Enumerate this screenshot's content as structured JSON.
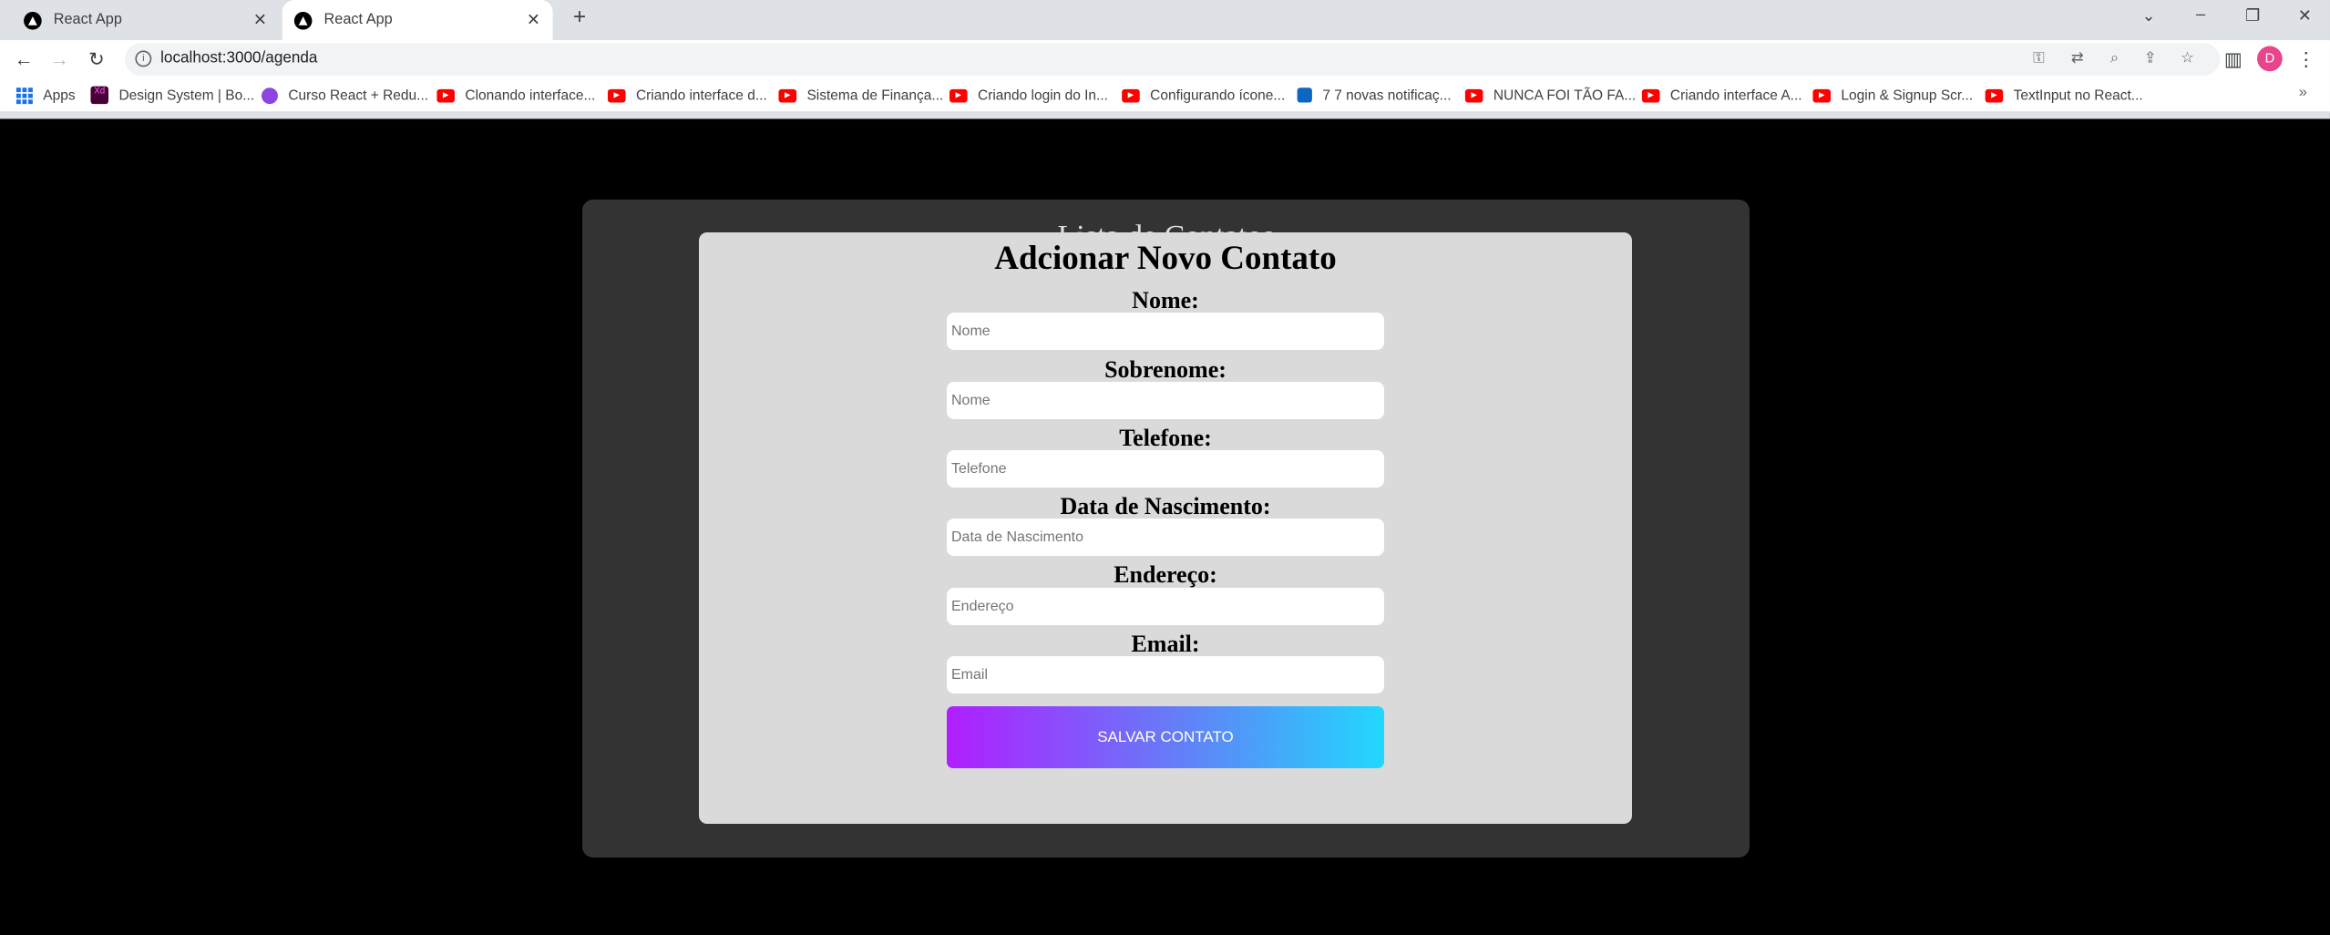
{
  "browser": {
    "tabs": [
      {
        "title": "React App",
        "active": false
      },
      {
        "title": "React App",
        "active": true
      }
    ],
    "url": "localhost:3000/agenda",
    "profile_initial": "D",
    "bookmarks": [
      {
        "label": "Apps",
        "icon": "apps-grid-icon"
      },
      {
        "label": "Design System | Bo...",
        "icon": "xd-icon"
      },
      {
        "label": "Curso React + Redu...",
        "icon": "redux-icon"
      },
      {
        "label": "Clonando interface...",
        "icon": "youtube-icon"
      },
      {
        "label": "Criando interface d...",
        "icon": "youtube-icon"
      },
      {
        "label": "Sistema de Finança...",
        "icon": "youtube-icon"
      },
      {
        "label": "Criando login do In...",
        "icon": "youtube-icon"
      },
      {
        "label": "Configurando ícone...",
        "icon": "youtube-icon"
      },
      {
        "label": "7 7 novas notificaç...",
        "icon": "linkedin-icon"
      },
      {
        "label": "NUNCA FOI TÃO FA...",
        "icon": "youtube-icon"
      },
      {
        "label": "Criando interface A...",
        "icon": "youtube-icon"
      },
      {
        "label": "Login & Signup Scr...",
        "icon": "youtube-icon"
      },
      {
        "label": "TextInput no React...",
        "icon": "youtube-icon"
      }
    ]
  },
  "panel": {
    "title": "Lista de Contatos"
  },
  "modal": {
    "title": "Adcionar Novo Contato",
    "fields": [
      {
        "label": "Nome:",
        "placeholder": "Nome",
        "value": ""
      },
      {
        "label": "Sobrenome:",
        "placeholder": "Nome",
        "value": ""
      },
      {
        "label": "Telefone:",
        "placeholder": "Telefone",
        "value": ""
      },
      {
        "label": "Data de Nascimento:",
        "placeholder": "Data de Nascimento",
        "value": ""
      },
      {
        "label": "Endereço:",
        "placeholder": "Endereço",
        "value": ""
      },
      {
        "label": "Email:",
        "placeholder": "Email",
        "value": ""
      }
    ],
    "save_label": "SALVAR CONTATO"
  },
  "colors": {
    "page_bg": "#000000",
    "panel_bg": "#333333",
    "modal_bg": "#dadada",
    "button_gradient_start": "#b01eff",
    "button_gradient_end": "#22d8ff"
  }
}
